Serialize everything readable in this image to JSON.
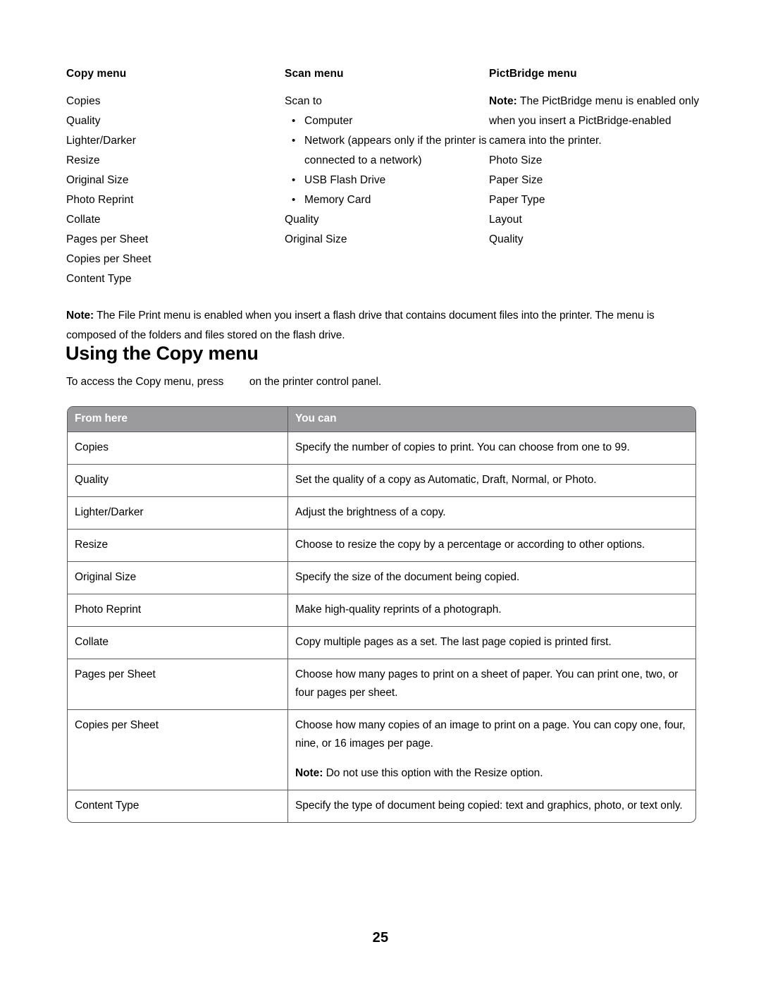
{
  "columns": {
    "copy": {
      "title": "Copy menu",
      "items": [
        "Copies",
        "Quality",
        "Lighter/Darker",
        "Resize",
        "Original Size",
        "Photo Reprint",
        "Collate",
        "Pages per Sheet",
        "Copies per Sheet",
        "Content Type"
      ]
    },
    "scan": {
      "title": "Scan menu",
      "lead": "Scan to",
      "bullets": [
        "Computer",
        "Network (appears only if the printer is connected to a network)",
        "USB Flash Drive",
        "Memory Card"
      ],
      "items_after": [
        "Quality",
        "Original Size"
      ]
    },
    "pictbridge": {
      "title": "PictBridge menu",
      "note_label": "Note:",
      "note_text": " The PictBridge menu is enabled only when you insert a PictBridge-enabled camera into the printer.",
      "items": [
        "Photo Size",
        "Paper Size",
        "Paper Type",
        "Layout",
        "Quality"
      ]
    }
  },
  "note_paragraph": {
    "label": "Note:",
    "text": " The File Print menu is enabled when you insert a flash drive that contains document files into the printer. The menu is composed of the folders and files stored on the flash drive."
  },
  "section": {
    "heading": "Using the Copy menu",
    "intro_before": "To access the Copy menu, press ",
    "icon_name": "copy-stack-icon",
    "intro_after": " on the printer control panel."
  },
  "table": {
    "headers": {
      "from_here": "From here",
      "you_can": "You can"
    },
    "rows": [
      {
        "from_here": "Copies",
        "you_can": "Specify the number of copies to print. You can choose from one to 99."
      },
      {
        "from_here": "Quality",
        "you_can": "Set the quality of a copy as Automatic, Draft, Normal, or Photo."
      },
      {
        "from_here": "Lighter/Darker",
        "you_can": "Adjust the brightness of a copy."
      },
      {
        "from_here": "Resize",
        "you_can": "Choose to resize the copy by a percentage or according to other options."
      },
      {
        "from_here": "Original Size",
        "you_can": "Specify the size of the document being copied."
      },
      {
        "from_here": "Photo Reprint",
        "you_can": "Make high-quality reprints of a photograph."
      },
      {
        "from_here": "Collate",
        "you_can": "Copy multiple pages as a set. The last page copied is printed first."
      },
      {
        "from_here": "Pages per Sheet",
        "you_can": "Choose how many pages to print on a sheet of paper. You can print one, two, or four pages per sheet."
      },
      {
        "from_here": "Copies per Sheet",
        "you_can": "Choose how many copies of an image to print on a page. You can copy one, four, nine, or 16 images per page.",
        "note_label": "Note:",
        "note_text": " Do not use this option with the Resize option."
      },
      {
        "from_here": "Content Type",
        "you_can": "Specify the type of document being copied: text and graphics, photo, or text only."
      }
    ]
  },
  "footer": {
    "page_number": "25"
  },
  "colors": {
    "header_background": "#9b9b9d",
    "header_text": "#ffffff",
    "border": "#58585a",
    "page_background": "#ffffff",
    "body_text": "#000000"
  }
}
